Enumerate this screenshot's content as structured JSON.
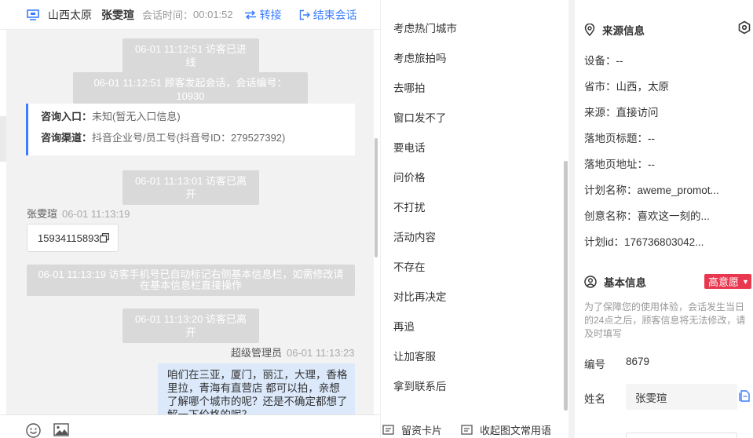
{
  "header": {
    "location": "山西太原",
    "visitor_name": "张雯瑄",
    "duration_label": "会话时间：",
    "duration_value": "00:01:52",
    "transfer_label": "转接",
    "end_label": "结束会话",
    "accent": "#3a7bff"
  },
  "chat": {
    "sys1": "06-01 11:12:51 访客已进线",
    "sys2": "06-01 11:12:51 顾客发起会话，会话编号：10930",
    "entry_key": "咨询入口：",
    "entry_val": "未知(暂无入口信息)",
    "channel_key": "咨询渠道：",
    "channel_val": "抖音企业号/员工号(抖音号ID：279527392)",
    "sys3": "06-01 11:13:01 访客已离开",
    "visitor_sender": "张雯瑄",
    "visitor_time": "06-01 11:13:19",
    "phone": "15934115893",
    "sys4": "06-01 11:13:19 访客手机号已自动标记右侧基本信息栏，如需修改请在基本信息栏直接操作",
    "sys5": "06-01 11:13:20 访客已离开",
    "agent_sender": "超级管理员",
    "agent_time": "06-01 11:13:23",
    "agent_message": "咱们在三亚，厦门，丽江，大理，香格里拉，青海有直营店 都可以拍，亲想了解哪个城市的呢？还是不确定都想了解一下价格的呢？"
  },
  "quick_replies": [
    "考虑热门城市",
    "考虑旅拍吗",
    "去哪拍",
    "窗口发不了",
    "要电话",
    "问价格",
    "不打扰",
    "活动内容",
    "不存在",
    "对比再决定",
    "再追",
    "让加客服",
    "拿到联系后"
  ],
  "quick_footer": {
    "card_label": "留资卡片",
    "common_label": "收起图文常用语"
  },
  "source": {
    "title": "来源信息",
    "device": "设备：--",
    "province": "省市：山西，太原",
    "origin": "来源：直接访问",
    "landing_title": "落地页标题：--",
    "landing_url": "落地页地址：--",
    "plan_name": "计划名称：aweme_promot...",
    "creative_name": "创意名称：喜欢这一刻的...",
    "plan_id": "计划id：176736803042..."
  },
  "basic": {
    "title": "基本信息",
    "intent_badge": "高意愿",
    "badge_color": "#e8384f",
    "notice": "为了保障您的使用体验，会话发生当日的24点之后，顾客信息将无法修改，请及时填写",
    "number_label": "编号",
    "number_value": "8679",
    "name_label": "姓名",
    "name_value": "张雯瑄"
  }
}
